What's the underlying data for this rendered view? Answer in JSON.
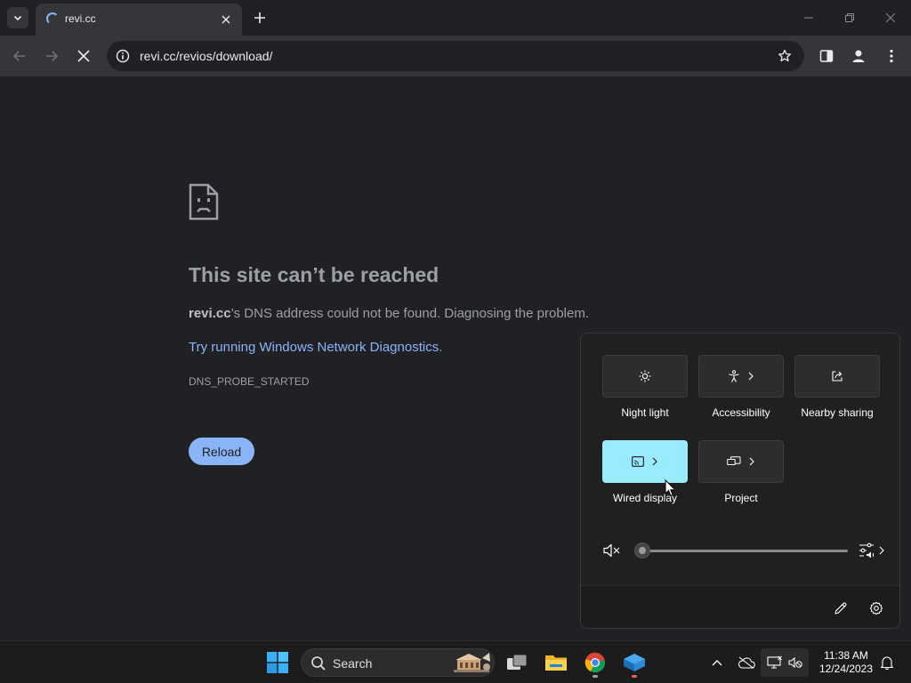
{
  "browser": {
    "tab": {
      "title": "revi.cc"
    },
    "address_bar": {
      "url": "revi.cc/revios/download/"
    }
  },
  "error_page": {
    "title": "This site can’t be reached",
    "host": "revi.cc",
    "description_suffix": "’s DNS address could not be found. Diagnosing the problem.",
    "link_text": "Try running Windows Network Diagnostics",
    "link_suffix": ".",
    "error_code": "DNS_PROBE_STARTED",
    "reload_label": "Reload"
  },
  "quick_settings": {
    "tiles": [
      {
        "label": "Night light",
        "icon": "brightness-icon",
        "active": false
      },
      {
        "label": "Accessibility",
        "icon": "accessibility-icon",
        "active": false
      },
      {
        "label": "Nearby sharing",
        "icon": "share-icon",
        "active": false
      },
      {
        "label": "Wired display",
        "icon": "cast-icon",
        "active": true
      },
      {
        "label": "Project",
        "icon": "project-icon",
        "active": false
      }
    ],
    "volume": {
      "muted": true,
      "level": 0
    }
  },
  "taskbar": {
    "search_label": "Search",
    "clock": {
      "time": "11:38 AM",
      "date": "12/24/2023"
    }
  },
  "colors": {
    "accent_tile": "#99ebff",
    "link": "#8ab4f8",
    "reload_button": "#8ab4f8"
  }
}
